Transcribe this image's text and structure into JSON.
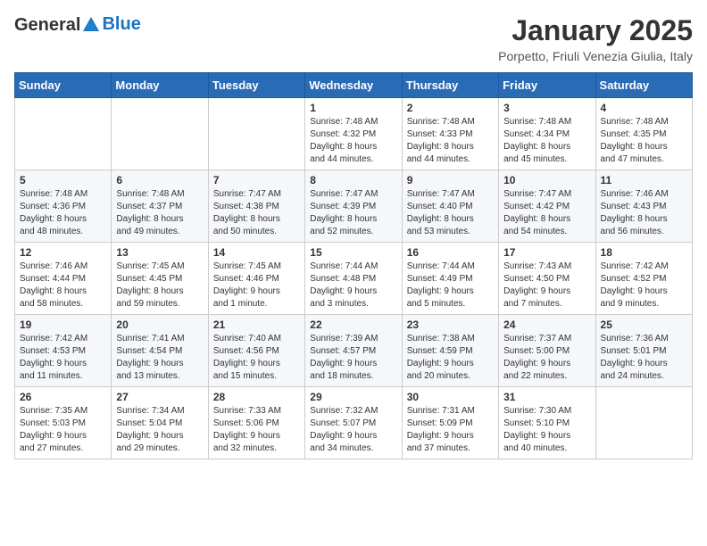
{
  "logo": {
    "general": "General",
    "blue": "Blue"
  },
  "title": "January 2025",
  "subtitle": "Porpetto, Friuli Venezia Giulia, Italy",
  "days_header": [
    "Sunday",
    "Monday",
    "Tuesday",
    "Wednesday",
    "Thursday",
    "Friday",
    "Saturday"
  ],
  "weeks": [
    [
      {
        "day": "",
        "info": ""
      },
      {
        "day": "",
        "info": ""
      },
      {
        "day": "",
        "info": ""
      },
      {
        "day": "1",
        "info": "Sunrise: 7:48 AM\nSunset: 4:32 PM\nDaylight: 8 hours\nand 44 minutes."
      },
      {
        "day": "2",
        "info": "Sunrise: 7:48 AM\nSunset: 4:33 PM\nDaylight: 8 hours\nand 44 minutes."
      },
      {
        "day": "3",
        "info": "Sunrise: 7:48 AM\nSunset: 4:34 PM\nDaylight: 8 hours\nand 45 minutes."
      },
      {
        "day": "4",
        "info": "Sunrise: 7:48 AM\nSunset: 4:35 PM\nDaylight: 8 hours\nand 47 minutes."
      }
    ],
    [
      {
        "day": "5",
        "info": "Sunrise: 7:48 AM\nSunset: 4:36 PM\nDaylight: 8 hours\nand 48 minutes."
      },
      {
        "day": "6",
        "info": "Sunrise: 7:48 AM\nSunset: 4:37 PM\nDaylight: 8 hours\nand 49 minutes."
      },
      {
        "day": "7",
        "info": "Sunrise: 7:47 AM\nSunset: 4:38 PM\nDaylight: 8 hours\nand 50 minutes."
      },
      {
        "day": "8",
        "info": "Sunrise: 7:47 AM\nSunset: 4:39 PM\nDaylight: 8 hours\nand 52 minutes."
      },
      {
        "day": "9",
        "info": "Sunrise: 7:47 AM\nSunset: 4:40 PM\nDaylight: 8 hours\nand 53 minutes."
      },
      {
        "day": "10",
        "info": "Sunrise: 7:47 AM\nSunset: 4:42 PM\nDaylight: 8 hours\nand 54 minutes."
      },
      {
        "day": "11",
        "info": "Sunrise: 7:46 AM\nSunset: 4:43 PM\nDaylight: 8 hours\nand 56 minutes."
      }
    ],
    [
      {
        "day": "12",
        "info": "Sunrise: 7:46 AM\nSunset: 4:44 PM\nDaylight: 8 hours\nand 58 minutes."
      },
      {
        "day": "13",
        "info": "Sunrise: 7:45 AM\nSunset: 4:45 PM\nDaylight: 8 hours\nand 59 minutes."
      },
      {
        "day": "14",
        "info": "Sunrise: 7:45 AM\nSunset: 4:46 PM\nDaylight: 9 hours\nand 1 minute."
      },
      {
        "day": "15",
        "info": "Sunrise: 7:44 AM\nSunset: 4:48 PM\nDaylight: 9 hours\nand 3 minutes."
      },
      {
        "day": "16",
        "info": "Sunrise: 7:44 AM\nSunset: 4:49 PM\nDaylight: 9 hours\nand 5 minutes."
      },
      {
        "day": "17",
        "info": "Sunrise: 7:43 AM\nSunset: 4:50 PM\nDaylight: 9 hours\nand 7 minutes."
      },
      {
        "day": "18",
        "info": "Sunrise: 7:42 AM\nSunset: 4:52 PM\nDaylight: 9 hours\nand 9 minutes."
      }
    ],
    [
      {
        "day": "19",
        "info": "Sunrise: 7:42 AM\nSunset: 4:53 PM\nDaylight: 9 hours\nand 11 minutes."
      },
      {
        "day": "20",
        "info": "Sunrise: 7:41 AM\nSunset: 4:54 PM\nDaylight: 9 hours\nand 13 minutes."
      },
      {
        "day": "21",
        "info": "Sunrise: 7:40 AM\nSunset: 4:56 PM\nDaylight: 9 hours\nand 15 minutes."
      },
      {
        "day": "22",
        "info": "Sunrise: 7:39 AM\nSunset: 4:57 PM\nDaylight: 9 hours\nand 18 minutes."
      },
      {
        "day": "23",
        "info": "Sunrise: 7:38 AM\nSunset: 4:59 PM\nDaylight: 9 hours\nand 20 minutes."
      },
      {
        "day": "24",
        "info": "Sunrise: 7:37 AM\nSunset: 5:00 PM\nDaylight: 9 hours\nand 22 minutes."
      },
      {
        "day": "25",
        "info": "Sunrise: 7:36 AM\nSunset: 5:01 PM\nDaylight: 9 hours\nand 24 minutes."
      }
    ],
    [
      {
        "day": "26",
        "info": "Sunrise: 7:35 AM\nSunset: 5:03 PM\nDaylight: 9 hours\nand 27 minutes."
      },
      {
        "day": "27",
        "info": "Sunrise: 7:34 AM\nSunset: 5:04 PM\nDaylight: 9 hours\nand 29 minutes."
      },
      {
        "day": "28",
        "info": "Sunrise: 7:33 AM\nSunset: 5:06 PM\nDaylight: 9 hours\nand 32 minutes."
      },
      {
        "day": "29",
        "info": "Sunrise: 7:32 AM\nSunset: 5:07 PM\nDaylight: 9 hours\nand 34 minutes."
      },
      {
        "day": "30",
        "info": "Sunrise: 7:31 AM\nSunset: 5:09 PM\nDaylight: 9 hours\nand 37 minutes."
      },
      {
        "day": "31",
        "info": "Sunrise: 7:30 AM\nSunset: 5:10 PM\nDaylight: 9 hours\nand 40 minutes."
      },
      {
        "day": "",
        "info": ""
      }
    ]
  ]
}
